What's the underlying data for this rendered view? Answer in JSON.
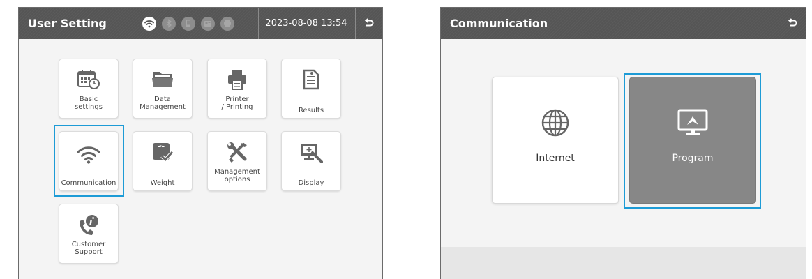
{
  "left_screen": {
    "title": "User Setting",
    "datetime": "2023-08-08 13:54",
    "status_icons": [
      "wifi-icon",
      "bluetooth-icon",
      "phone-icon",
      "card-reader-icon",
      "printer-icon"
    ],
    "tiles": [
      {
        "label": "Basic\nsettings",
        "icon": "calendar-clock-icon"
      },
      {
        "label": "Data\nManagement",
        "icon": "folder-icon"
      },
      {
        "label": "Printer\n/ Printing",
        "icon": "printer-icon"
      },
      {
        "label": "Results",
        "icon": "document-icon"
      },
      {
        "label": "Communication",
        "icon": "wifi-icon",
        "selected": true
      },
      {
        "label": "Weight",
        "icon": "scale-icon"
      },
      {
        "label": "Management\noptions",
        "icon": "tools-icon"
      },
      {
        "label": "Display",
        "icon": "monitor-icon"
      },
      {
        "label": "Customer\nSupport",
        "icon": "phone-info-icon"
      }
    ]
  },
  "right_screen": {
    "title": "Communication",
    "options": [
      {
        "label": "Internet",
        "icon": "globe-icon"
      },
      {
        "label": "Program",
        "icon": "monitor-program-icon",
        "selected": true
      }
    ]
  },
  "colors": {
    "header": "#555555",
    "selection": "#1d9bd6",
    "icon": "#666666",
    "selected_tile": "#878787"
  }
}
